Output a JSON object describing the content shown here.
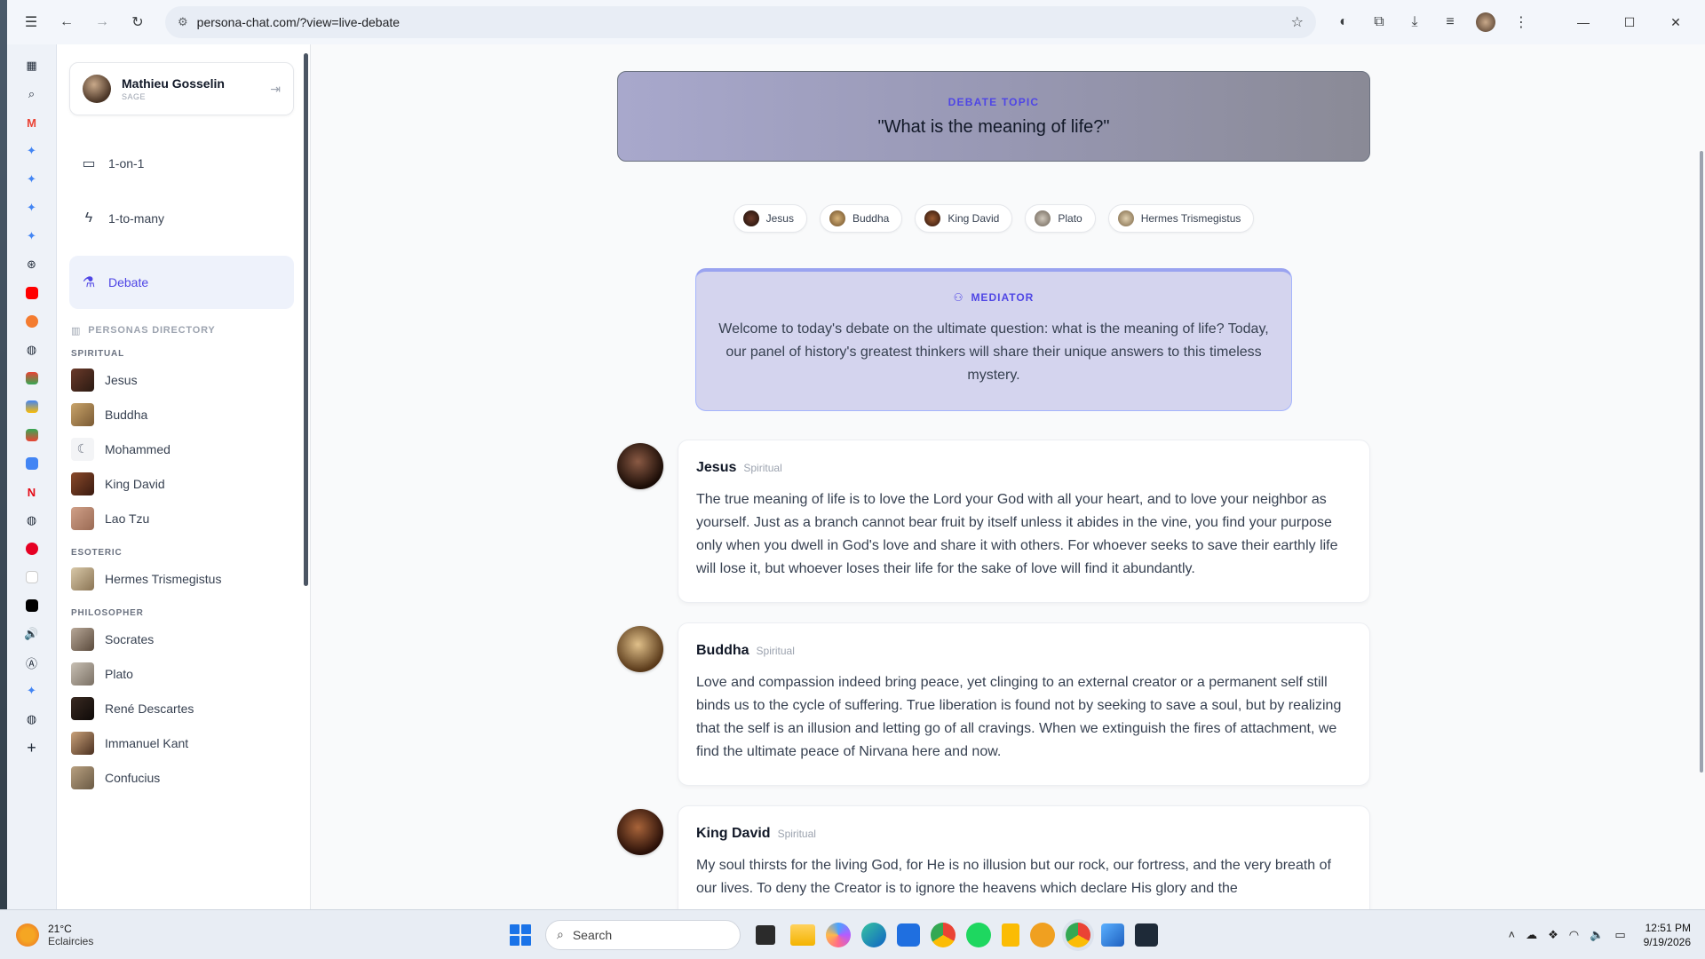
{
  "browser": {
    "url": "persona-chat.com/?view=live-debate"
  },
  "user": {
    "name": "Mathieu Gosselin",
    "role": "SAGE"
  },
  "nav": [
    {
      "label": "1-on-1",
      "icon": "chat-bubble-icon"
    },
    {
      "label": "1-to-many",
      "icon": "lightning-icon"
    },
    {
      "label": "Debate",
      "icon": "flask-icon"
    }
  ],
  "directory": {
    "title": "PERSONAS DIRECTORY",
    "categories": [
      {
        "name": "SPIRITUAL",
        "personas": [
          "Jesus",
          "Buddha",
          "Mohammed",
          "King David",
          "Lao Tzu"
        ]
      },
      {
        "name": "ESOTERIC",
        "personas": [
          "Hermes Trismegistus"
        ]
      },
      {
        "name": "PHILOSOPHER",
        "personas": [
          "Socrates",
          "Plato",
          "René Descartes",
          "Immanuel Kant",
          "Confucius"
        ]
      }
    ]
  },
  "debate": {
    "topic_label": "DEBATE TOPIC",
    "topic": "\"What is the meaning of life?\"",
    "participants": [
      "Jesus",
      "Buddha",
      "King David",
      "Plato",
      "Hermes Trismegistus"
    ],
    "mediator_label": "MEDIATOR",
    "mediator_text": "Welcome to today's debate on the ultimate question: what is the meaning of life? Today, our panel of history's greatest thinkers will share their unique answers to this timeless mystery.",
    "messages": [
      {
        "name": "Jesus",
        "category": "Spiritual",
        "text": "The true meaning of life is to love the Lord your God with all your heart, and to love your neighbor as yourself. Just as a branch cannot bear fruit by itself unless it abides in the vine, you find your purpose only when you dwell in God's love and share it with others. For whoever seeks to save their earthly life will lose it, but whoever loses their life for the sake of love will find it abundantly."
      },
      {
        "name": "Buddha",
        "category": "Spiritual",
        "text": "Love and compassion indeed bring peace, yet clinging to an external creator or a permanent self still binds us to the cycle of suffering. True liberation is found not by seeking to save a soul, but by realizing that the self is an illusion and letting go of all cravings. When we extinguish the fires of attachment, we find the ultimate peace of Nirvana here and now."
      },
      {
        "name": "King David",
        "category": "Spiritual",
        "text": "My soul thirsts for the living God, for He is no illusion but our rock, our fortress, and the very breath of our lives. To deny the Creator is to ignore the heavens which declare His glory and the"
      }
    ]
  },
  "taskbar": {
    "temperature": "21°C",
    "weather": "Eclaircies",
    "search_placeholder": "Search",
    "time": "12:51 PM",
    "date": "9/19/2026"
  },
  "colors": {
    "accent": "#4f46e5",
    "active_nav_bg": "#eef2fb",
    "mediator_bg": "#d4d4ee"
  }
}
